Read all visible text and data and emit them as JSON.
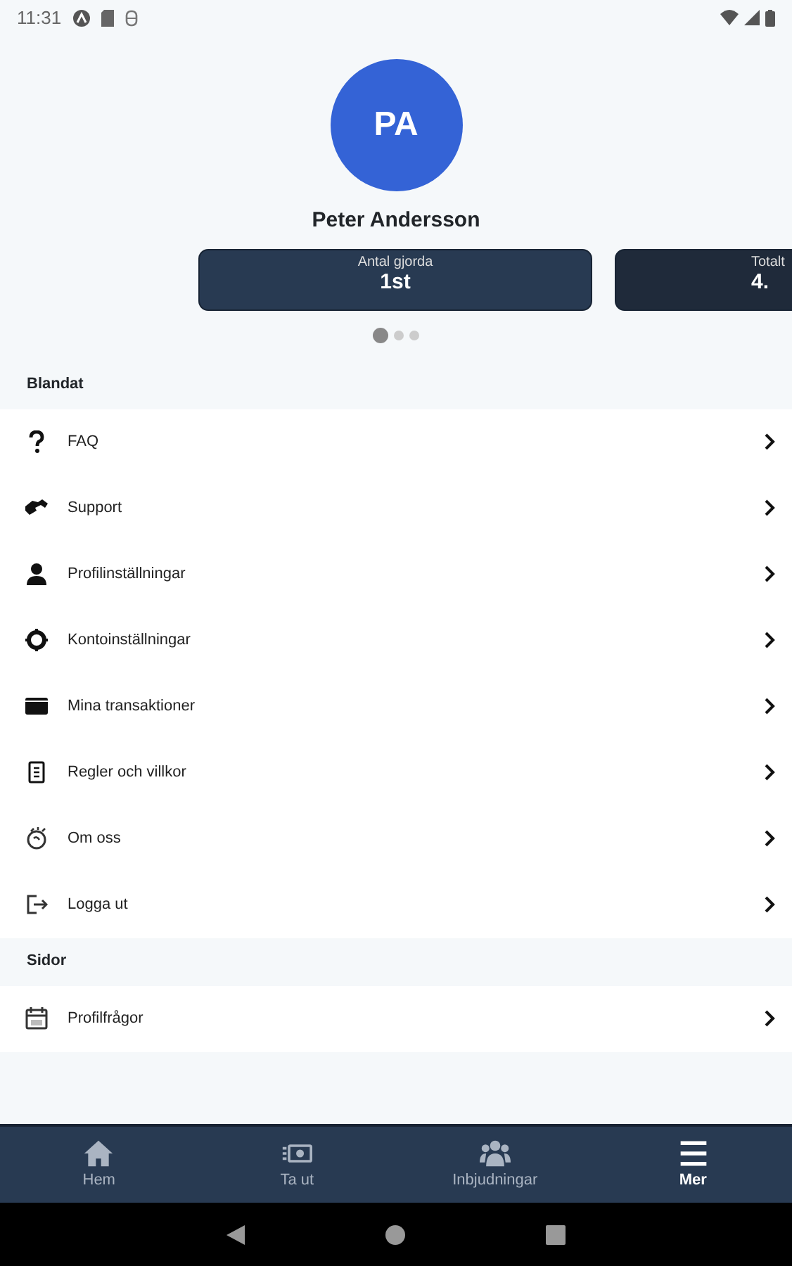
{
  "status_bar": {
    "time": "11:31"
  },
  "profile": {
    "initials": "PA",
    "name": "Peter Andersson"
  },
  "stats": [
    {
      "label": "Antal gjorda",
      "value": "1st"
    },
    {
      "label": "Totalt",
      "value": "4."
    }
  ],
  "pager": [
    {
      "selected": true
    },
    {
      "selected": false
    },
    {
      "selected": false
    }
  ],
  "sections": [
    {
      "title": "Blandat",
      "items": [
        {
          "label": "FAQ"
        },
        {
          "label": "Support"
        },
        {
          "label": "Profilinställningar"
        },
        {
          "label": "Kontoinställningar"
        },
        {
          "label": "Mina transaktioner"
        },
        {
          "label": "Regler och villkor"
        },
        {
          "label": "Om oss"
        },
        {
          "label": "Logga ut"
        }
      ]
    },
    {
      "title": "Sidor",
      "items": [
        {
          "label": "Profilfrågor"
        }
      ]
    }
  ],
  "bottom_nav": [
    {
      "label": "Hem",
      "selected": false
    },
    {
      "label": "Ta ut",
      "selected": false
    },
    {
      "label": "Inbjudningar",
      "selected": false
    },
    {
      "label": "Mer",
      "selected": true
    }
  ]
}
